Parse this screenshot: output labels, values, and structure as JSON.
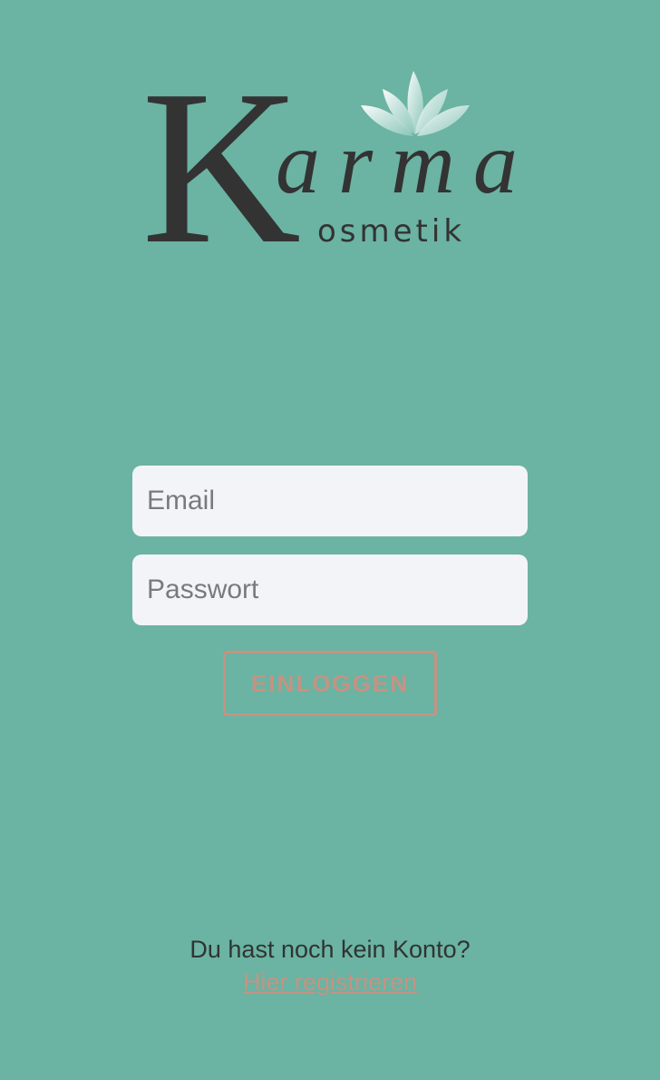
{
  "brand": {
    "logo_letter": "K",
    "logo_word": "arma",
    "logo_subtitle": "osmetik",
    "text_color": "#333333",
    "lotus_color": "#dbeee8"
  },
  "login_form": {
    "email_placeholder": "Email",
    "password_placeholder": "Passwort",
    "submit_label": "EINLOGGEN"
  },
  "register": {
    "prompt": "Du hast noch kein Konto?",
    "link_label": "Hier registrieren"
  },
  "colors": {
    "background": "#6bb3a2",
    "input_background": "#f3f4f8",
    "accent": "#c59383"
  }
}
